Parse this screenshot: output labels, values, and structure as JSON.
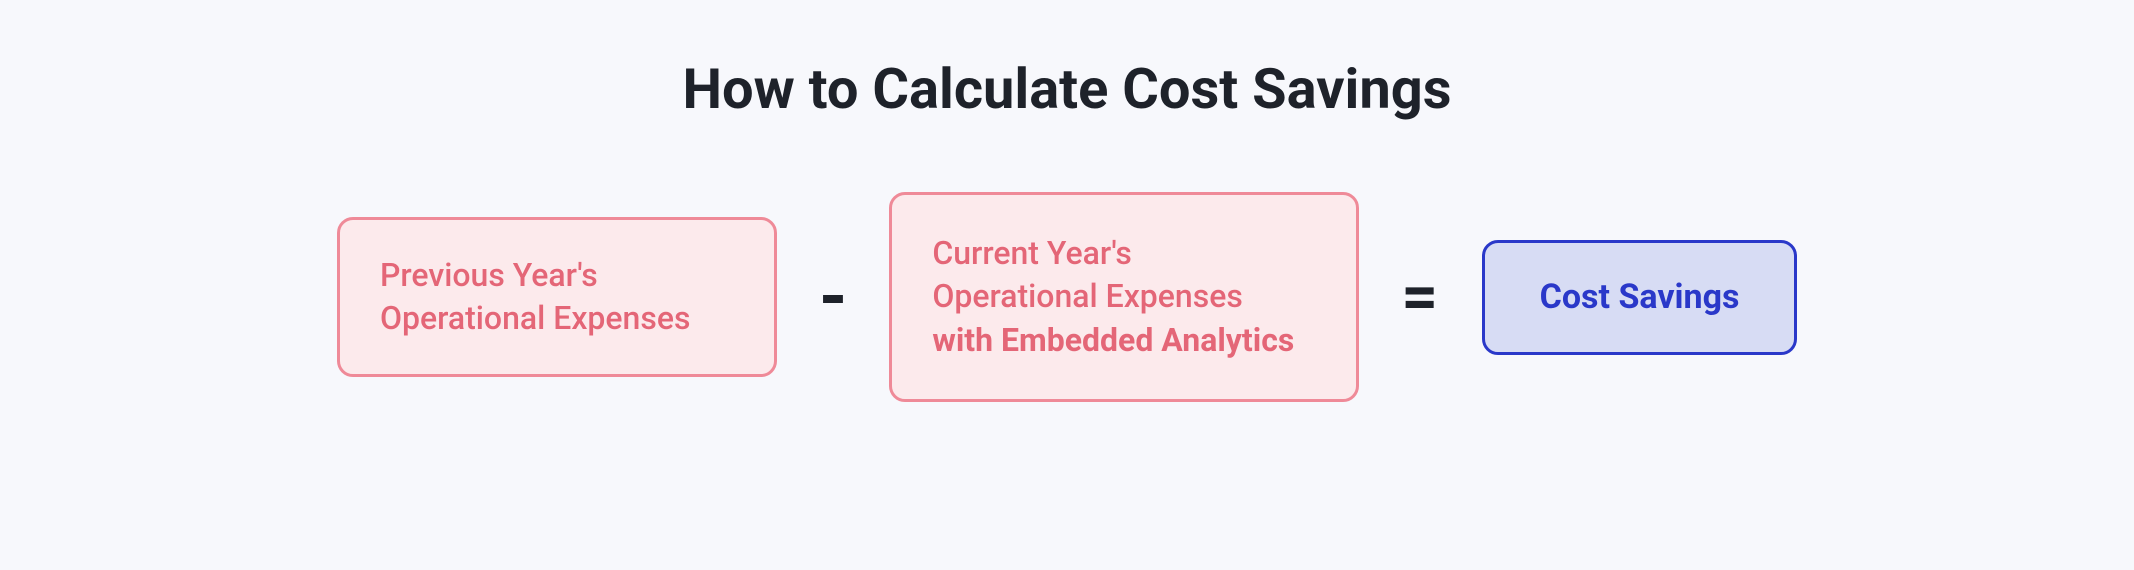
{
  "title": "How to Calculate Cost Savings",
  "formula": {
    "box1_line1": "Previous Year's",
    "box1_line2": "Operational Expenses",
    "minus": "-",
    "box2_line1": "Current Year's",
    "box2_line2": "Operational Expenses",
    "box2_line3": "with Embedded Analytics",
    "equals": "=",
    "box3": "Cost Savings"
  }
}
